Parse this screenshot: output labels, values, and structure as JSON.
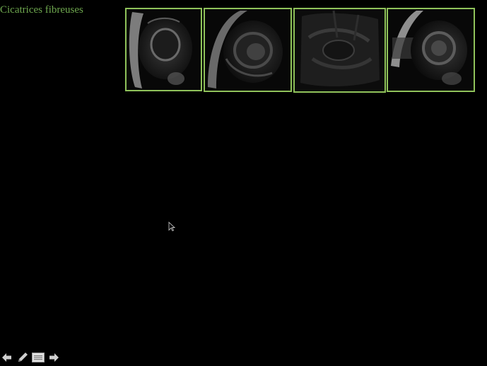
{
  "slide": {
    "title": "Cicatrices fibreuses"
  },
  "thumbnails": [
    {
      "name": "cardiac-mri-short-axis-1",
      "view": "short-axis"
    },
    {
      "name": "cardiac-mri-short-axis-2",
      "view": "short-axis"
    },
    {
      "name": "cardiac-mri-long-axis-3",
      "view": "long-axis"
    },
    {
      "name": "cardiac-mri-short-axis-4",
      "view": "short-axis"
    }
  ],
  "colors": {
    "background": "#000000",
    "title": "#6fa84f",
    "thumbnail_border": "#8fc25a",
    "nav_icon": "#cfcfcf"
  },
  "nav": {
    "buttons": [
      "previous-slide-icon",
      "pen-icon",
      "slide-menu-icon",
      "next-slide-icon"
    ]
  }
}
